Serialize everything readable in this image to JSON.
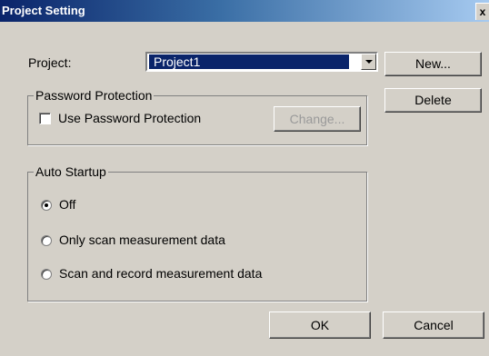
{
  "window": {
    "title": "Project Setting",
    "close_label": "x"
  },
  "project": {
    "label": "Project:",
    "selected": "Project1"
  },
  "buttons": {
    "new": "New...",
    "delete": "Delete",
    "change": "Change...",
    "ok": "OK",
    "cancel": "Cancel"
  },
  "password": {
    "group_label": "Password Protection",
    "checkbox_label": "Use Password Protection",
    "checked": false
  },
  "auto_startup": {
    "group_label": "Auto Startup",
    "options": [
      {
        "label": "Off",
        "selected": true
      },
      {
        "label": "Only scan measurement data",
        "selected": false
      },
      {
        "label": "Scan and record measurement data",
        "selected": false
      }
    ]
  }
}
